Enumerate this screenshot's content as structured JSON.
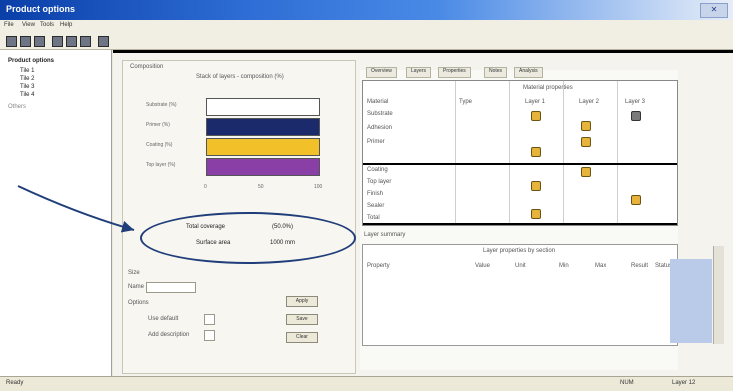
{
  "window": {
    "title": "Product options",
    "close_label": "✕"
  },
  "menu": [
    "File",
    "View",
    "Tools",
    "Help"
  ],
  "tree": [
    "Product options",
    "Tile 1",
    "Tile 2",
    "Tile 3",
    "Tile 4",
    "Others"
  ],
  "left_panel": {
    "section_title": "Composition",
    "chart_title": "Stack of layers - composition (%)",
    "layer_labels": [
      "Substrate (%)",
      "Primer (%)",
      "Coating (%)",
      "Top layer (%)"
    ],
    "x_ticks": [
      "0",
      "50",
      "100"
    ],
    "oval_line1_label": "Total coverage",
    "oval_line1_value": "(50.0%)",
    "oval_line2_label": "Surface area",
    "oval_line2_value": "1000 mm",
    "size_section": "Size",
    "size_field_label": "Name",
    "options_label": "Options",
    "opt1": "Use default",
    "opt2": "Add description",
    "btn1": "Apply",
    "btn2": "Save",
    "btn3": "Clear"
  },
  "tabs": [
    "Overview",
    "Layers",
    "Properties",
    "Notes",
    "Analysis"
  ],
  "grid": {
    "header_group": "Material properties",
    "col_heads": [
      "Material",
      "Type",
      "Layer 1",
      "Layer 2",
      "Layer 3"
    ],
    "row_labels": [
      "Substrate",
      "Adhesion",
      "Primer",
      "Coating",
      "Top layer",
      "Finish",
      "Sealer",
      "Total"
    ]
  },
  "grid2": {
    "title": "Layer summary",
    "group_head": "Layer properties by section",
    "col_heads": [
      "Property",
      "Value",
      "Unit",
      "Min",
      "Max",
      "Result",
      "Status"
    ]
  },
  "status": {
    "left": "Ready",
    "mid": "NUM",
    "right": "Layer 12"
  },
  "colors": {
    "layer_white": "#ffffff",
    "layer_navy": "#1a2a6b",
    "layer_yellow": "#f2c12a",
    "layer_purple": "#8a3fa6",
    "oval": "#1f3e7a"
  }
}
